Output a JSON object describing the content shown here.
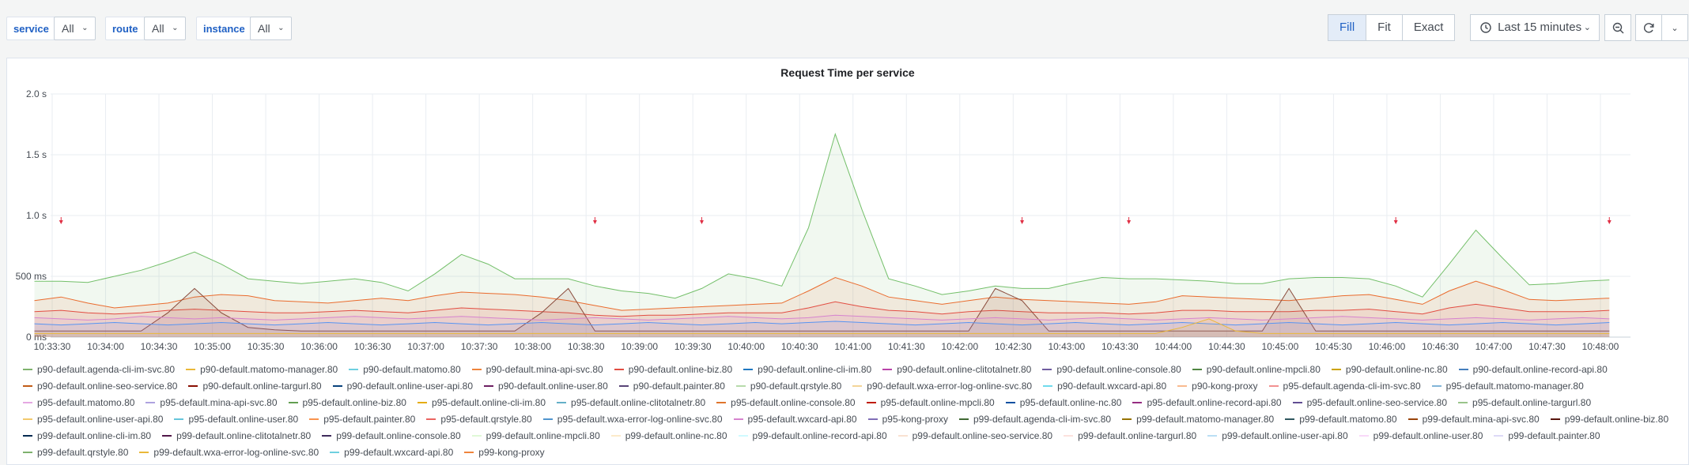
{
  "variables": [
    {
      "label": "service",
      "value": "All"
    },
    {
      "label": "route",
      "value": "All"
    },
    {
      "label": "instance",
      "value": "All"
    }
  ],
  "scale_buttons": [
    {
      "label": "Fill",
      "active": true
    },
    {
      "label": "Fit",
      "active": false
    },
    {
      "label": "Exact",
      "active": false
    }
  ],
  "time_range": {
    "label": "Last 15 minutes"
  },
  "icons": {
    "clock": "clock-icon",
    "zoom_out": "zoom-out-icon",
    "refresh": "refresh-icon",
    "chevron": "chevron-down-icon"
  },
  "panel": {
    "title": "Request Time per service"
  },
  "chart_data": {
    "type": "area",
    "title": "Request Time per service",
    "y_ticks": [
      {
        "value": 0,
        "label": "0 ms"
      },
      {
        "value": 0.5,
        "label": "500 ms"
      },
      {
        "value": 1.0,
        "label": "1.0 s"
      },
      {
        "value": 1.5,
        "label": "1.5 s"
      },
      {
        "value": 2.0,
        "label": "2.0 s"
      }
    ],
    "ylim": [
      0,
      2.0
    ],
    "x_ticks": [
      "10:33:30",
      "10:34:00",
      "10:34:30",
      "10:35:00",
      "10:35:30",
      "10:36:00",
      "10:36:30",
      "10:37:00",
      "10:37:30",
      "10:38:00",
      "10:38:30",
      "10:39:00",
      "10:39:30",
      "10:40:00",
      "10:40:30",
      "10:41:00",
      "10:41:30",
      "10:42:00",
      "10:42:30",
      "10:43:00",
      "10:43:30",
      "10:44:00",
      "10:44:30",
      "10:45:00",
      "10:45:30",
      "10:46:00",
      "10:46:30",
      "10:47:00",
      "10:47:30",
      "10:48:00"
    ],
    "x_times": [
      "10:33:20",
      "10:33:35",
      "10:33:50",
      "10:34:05",
      "10:34:20",
      "10:34:35",
      "10:34:50",
      "10:35:05",
      "10:35:20",
      "10:35:35",
      "10:35:50",
      "10:36:05",
      "10:36:20",
      "10:36:35",
      "10:36:50",
      "10:37:05",
      "10:37:20",
      "10:37:35",
      "10:37:50",
      "10:38:05",
      "10:38:20",
      "10:38:35",
      "10:38:50",
      "10:39:05",
      "10:39:20",
      "10:39:35",
      "10:39:50",
      "10:40:05",
      "10:40:20",
      "10:40:35",
      "10:40:50",
      "10:41:05",
      "10:41:20",
      "10:41:35",
      "10:41:50",
      "10:42:05",
      "10:42:20",
      "10:42:35",
      "10:42:50",
      "10:43:05",
      "10:43:20",
      "10:43:35",
      "10:43:50",
      "10:44:05",
      "10:44:20",
      "10:44:35",
      "10:44:50",
      "10:45:05",
      "10:45:20",
      "10:45:35",
      "10:45:50",
      "10:46:05",
      "10:46:20",
      "10:46:35",
      "10:46:50",
      "10:47:05",
      "10:47:20",
      "10:47:35",
      "10:47:50",
      "10:48:05"
    ],
    "grid": true,
    "legend_position": "bottom",
    "series": [
      {
        "name": "p99-kong-proxy",
        "color": "#73bf69",
        "values": [
          0.46,
          0.46,
          0.45,
          0.5,
          0.55,
          0.62,
          0.7,
          0.6,
          0.48,
          0.46,
          0.44,
          0.46,
          0.48,
          0.45,
          0.38,
          0.52,
          0.68,
          0.6,
          0.48,
          0.48,
          0.48,
          0.42,
          0.38,
          0.36,
          0.32,
          0.4,
          0.52,
          0.48,
          0.42,
          0.9,
          1.67,
          1.05,
          0.48,
          0.42,
          0.35,
          0.38,
          0.42,
          0.4,
          0.4,
          0.45,
          0.49,
          0.48,
          0.48,
          0.47,
          0.46,
          0.44,
          0.44,
          0.48,
          0.49,
          0.49,
          0.48,
          0.42,
          0.33,
          0.6,
          0.88,
          0.65,
          0.43,
          0.44,
          0.46,
          0.47
        ]
      },
      {
        "name": "p95-kong-proxy",
        "color": "#ea6b2d",
        "values": [
          0.3,
          0.33,
          0.28,
          0.24,
          0.26,
          0.28,
          0.33,
          0.35,
          0.34,
          0.3,
          0.29,
          0.28,
          0.3,
          0.32,
          0.3,
          0.34,
          0.37,
          0.36,
          0.35,
          0.33,
          0.3,
          0.26,
          0.22,
          0.23,
          0.24,
          0.25,
          0.26,
          0.27,
          0.28,
          0.38,
          0.49,
          0.42,
          0.33,
          0.3,
          0.27,
          0.3,
          0.33,
          0.31,
          0.3,
          0.29,
          0.28,
          0.27,
          0.29,
          0.34,
          0.33,
          0.32,
          0.31,
          0.3,
          0.32,
          0.34,
          0.35,
          0.31,
          0.27,
          0.38,
          0.46,
          0.39,
          0.31,
          0.3,
          0.31,
          0.32
        ]
      },
      {
        "name": "p90-kong-proxy",
        "color": "#e24d42",
        "values": [
          0.21,
          0.22,
          0.2,
          0.19,
          0.2,
          0.22,
          0.23,
          0.22,
          0.21,
          0.2,
          0.2,
          0.21,
          0.22,
          0.21,
          0.2,
          0.22,
          0.24,
          0.23,
          0.22,
          0.21,
          0.2,
          0.18,
          0.17,
          0.18,
          0.18,
          0.19,
          0.2,
          0.2,
          0.2,
          0.24,
          0.29,
          0.25,
          0.22,
          0.21,
          0.19,
          0.21,
          0.22,
          0.21,
          0.2,
          0.2,
          0.2,
          0.19,
          0.2,
          0.22,
          0.22,
          0.21,
          0.21,
          0.21,
          0.22,
          0.22,
          0.23,
          0.21,
          0.19,
          0.24,
          0.27,
          0.24,
          0.21,
          0.21,
          0.21,
          0.22
        ]
      },
      {
        "name": "p99-default.painter.80",
        "color": "#8a4a3a",
        "values": [
          0.05,
          0.05,
          0.05,
          0.05,
          0.05,
          0.2,
          0.4,
          0.2,
          0.08,
          0.06,
          0.05,
          0.05,
          0.05,
          0.05,
          0.05,
          0.05,
          0.05,
          0.05,
          0.05,
          0.2,
          0.4,
          0.05,
          0.05,
          0.05,
          0.05,
          0.05,
          0.05,
          0.05,
          0.05,
          0.05,
          0.05,
          0.05,
          0.05,
          0.05,
          0.05,
          0.05,
          0.4,
          0.3,
          0.05,
          0.05,
          0.05,
          0.05,
          0.05,
          0.05,
          0.05,
          0.05,
          0.05,
          0.4,
          0.05,
          0.05,
          0.05,
          0.05,
          0.05,
          0.05,
          0.05,
          0.05,
          0.05,
          0.05,
          0.05,
          0.05
        ]
      },
      {
        "name": "p95-default.matomo.80",
        "color": "#d683ce",
        "values": [
          0.16,
          0.15,
          0.14,
          0.15,
          0.17,
          0.16,
          0.15,
          0.16,
          0.15,
          0.14,
          0.15,
          0.16,
          0.17,
          0.16,
          0.15,
          0.16,
          0.17,
          0.16,
          0.15,
          0.14,
          0.15,
          0.16,
          0.15,
          0.14,
          0.15,
          0.16,
          0.17,
          0.16,
          0.15,
          0.16,
          0.18,
          0.17,
          0.16,
          0.15,
          0.14,
          0.15,
          0.16,
          0.15,
          0.14,
          0.15,
          0.16,
          0.15,
          0.14,
          0.15,
          0.16,
          0.15,
          0.14,
          0.15,
          0.16,
          0.17,
          0.16,
          0.15,
          0.14,
          0.15,
          0.16,
          0.15,
          0.14,
          0.15,
          0.16,
          0.15
        ]
      },
      {
        "name": "p90-default.online-cli-im.80",
        "color": "#5794f2",
        "values": [
          0.11,
          0.1,
          0.11,
          0.12,
          0.11,
          0.1,
          0.11,
          0.12,
          0.11,
          0.1,
          0.11,
          0.12,
          0.11,
          0.1,
          0.11,
          0.12,
          0.11,
          0.1,
          0.11,
          0.12,
          0.11,
          0.1,
          0.11,
          0.12,
          0.11,
          0.1,
          0.11,
          0.12,
          0.11,
          0.12,
          0.13,
          0.12,
          0.11,
          0.1,
          0.11,
          0.12,
          0.11,
          0.1,
          0.11,
          0.12,
          0.11,
          0.1,
          0.11,
          0.12,
          0.11,
          0.1,
          0.11,
          0.12,
          0.11,
          0.1,
          0.11,
          0.12,
          0.11,
          0.1,
          0.11,
          0.12,
          0.11,
          0.1,
          0.11,
          0.12
        ]
      },
      {
        "name": "p95-default.wxcard-api.80",
        "color": "#eab839",
        "values": [
          0.03,
          0.03,
          0.03,
          0.03,
          0.03,
          0.03,
          0.03,
          0.03,
          0.03,
          0.03,
          0.03,
          0.03,
          0.03,
          0.03,
          0.03,
          0.03,
          0.03,
          0.03,
          0.03,
          0.03,
          0.03,
          0.03,
          0.03,
          0.03,
          0.03,
          0.03,
          0.03,
          0.03,
          0.03,
          0.03,
          0.03,
          0.03,
          0.03,
          0.03,
          0.03,
          0.03,
          0.03,
          0.03,
          0.03,
          0.03,
          0.03,
          0.03,
          0.03,
          0.08,
          0.15,
          0.05,
          0.03,
          0.03,
          0.03,
          0.03,
          0.03,
          0.03,
          0.03,
          0.03,
          0.03,
          0.03,
          0.03,
          0.03,
          0.03,
          0.03
        ]
      }
    ],
    "annotations": [
      "10:33:35",
      "10:38:35",
      "10:39:35",
      "10:42:35",
      "10:43:35",
      "10:46:05",
      "10:48:05"
    ]
  },
  "legend": [
    {
      "name": "p90-default.agenda-cli-im-svc.80",
      "color": "#7eb26d"
    },
    {
      "name": "p90-default.matomo-manager.80",
      "color": "#eab839"
    },
    {
      "name": "p90-default.matomo.80",
      "color": "#6ed0e0"
    },
    {
      "name": "p90-default.mina-api-svc.80",
      "color": "#ef843c"
    },
    {
      "name": "p90-default.online-biz.80",
      "color": "#e24d42"
    },
    {
      "name": "p90-default.online-cli-im.80",
      "color": "#1f78c1"
    },
    {
      "name": "p90-default.online-clitotalnetr.80",
      "color": "#ba43a9"
    },
    {
      "name": "p90-default.online-console.80",
      "color": "#705da0"
    },
    {
      "name": "p90-default.online-mpcli.80",
      "color": "#508642"
    },
    {
      "name": "p90-default.online-nc.80",
      "color": "#cca300"
    },
    {
      "name": "p90-default.online-record-api.80",
      "color": "#447ebc"
    },
    {
      "name": "p90-default.online-seo-service.80",
      "color": "#c15c17"
    },
    {
      "name": "p90-default.online-targurl.80",
      "color": "#890f02"
    },
    {
      "name": "p90-default.online-user-api.80",
      "color": "#0a437c"
    },
    {
      "name": "p90-default.online-user.80",
      "color": "#6d1f62"
    },
    {
      "name": "p90-default.painter.80",
      "color": "#584477"
    },
    {
      "name": "p90-default.qrstyle.80",
      "color": "#b7dbab"
    },
    {
      "name": "p90-default.wxa-error-log-online-svc.80",
      "color": "#f4d598"
    },
    {
      "name": "p90-default.wxcard-api.80",
      "color": "#70dbed"
    },
    {
      "name": "p90-kong-proxy",
      "color": "#f9ba8f"
    },
    {
      "name": "p95-default.agenda-cli-im-svc.80",
      "color": "#f29191"
    },
    {
      "name": "p95-default.matomo-manager.80",
      "color": "#82b5d8"
    },
    {
      "name": "p95-default.matomo.80",
      "color": "#e5a8e2"
    },
    {
      "name": "p95-default.mina-api-svc.80",
      "color": "#aea2e0"
    },
    {
      "name": "p95-default.online-biz.80",
      "color": "#629e51"
    },
    {
      "name": "p95-default.online-cli-im.80",
      "color": "#e5ac0e"
    },
    {
      "name": "p95-default.online-clitotalnetr.80",
      "color": "#64b0c8"
    },
    {
      "name": "p95-default.online-console.80",
      "color": "#e0752d"
    },
    {
      "name": "p95-default.online-mpcli.80",
      "color": "#bf1b00"
    },
    {
      "name": "p95-default.online-nc.80",
      "color": "#0a50a1"
    },
    {
      "name": "p95-default.online-record-api.80",
      "color": "#962d82"
    },
    {
      "name": "p95-default.online-seo-service.80",
      "color": "#614d93"
    },
    {
      "name": "p95-default.online-targurl.80",
      "color": "#9ac48a"
    },
    {
      "name": "p95-default.online-user-api.80",
      "color": "#f2c96d"
    },
    {
      "name": "p95-default.online-user.80",
      "color": "#65c5db"
    },
    {
      "name": "p95-default.painter.80",
      "color": "#f9934e"
    },
    {
      "name": "p95-default.qrstyle.80",
      "color": "#ea6460"
    },
    {
      "name": "p95-default.wxa-error-log-online-svc.80",
      "color": "#5195ce"
    },
    {
      "name": "p95-default.wxcard-api.80",
      "color": "#d683ce"
    },
    {
      "name": "p95-kong-proxy",
      "color": "#806eb7"
    },
    {
      "name": "p99-default.agenda-cli-im-svc.80",
      "color": "#3f6833"
    },
    {
      "name": "p99-default.matomo-manager.80",
      "color": "#967302"
    },
    {
      "name": "p99-default.matomo.80",
      "color": "#2f575e"
    },
    {
      "name": "p99-default.mina-api-svc.80",
      "color": "#99440a"
    },
    {
      "name": "p99-default.online-biz.80",
      "color": "#58140c"
    },
    {
      "name": "p99-default.online-cli-im.80",
      "color": "#052b51"
    },
    {
      "name": "p99-default.online-clitotalnetr.80",
      "color": "#511749"
    },
    {
      "name": "p99-default.online-console.80",
      "color": "#3f2b5b"
    },
    {
      "name": "p99-default.online-mpcli.80",
      "color": "#e0f9d7"
    },
    {
      "name": "p99-default.online-nc.80",
      "color": "#fceaca"
    },
    {
      "name": "p99-default.online-record-api.80",
      "color": "#cffaff"
    },
    {
      "name": "p99-default.online-seo-service.80",
      "color": "#f9e2d2"
    },
    {
      "name": "p99-default.online-targurl.80",
      "color": "#fce2de"
    },
    {
      "name": "p99-default.online-user-api.80",
      "color": "#badff4"
    },
    {
      "name": "p99-default.online-user.80",
      "color": "#f9d9f9"
    },
    {
      "name": "p99-default.painter.80",
      "color": "#dedaf7"
    },
    {
      "name": "p99-default.qrstyle.80",
      "color": "#7eb26d"
    },
    {
      "name": "p99-default.wxa-error-log-online-svc.80",
      "color": "#eab839"
    },
    {
      "name": "p99-default.wxcard-api.80",
      "color": "#6ed0e0"
    },
    {
      "name": "p99-kong-proxy",
      "color": "#ef843c"
    }
  ]
}
